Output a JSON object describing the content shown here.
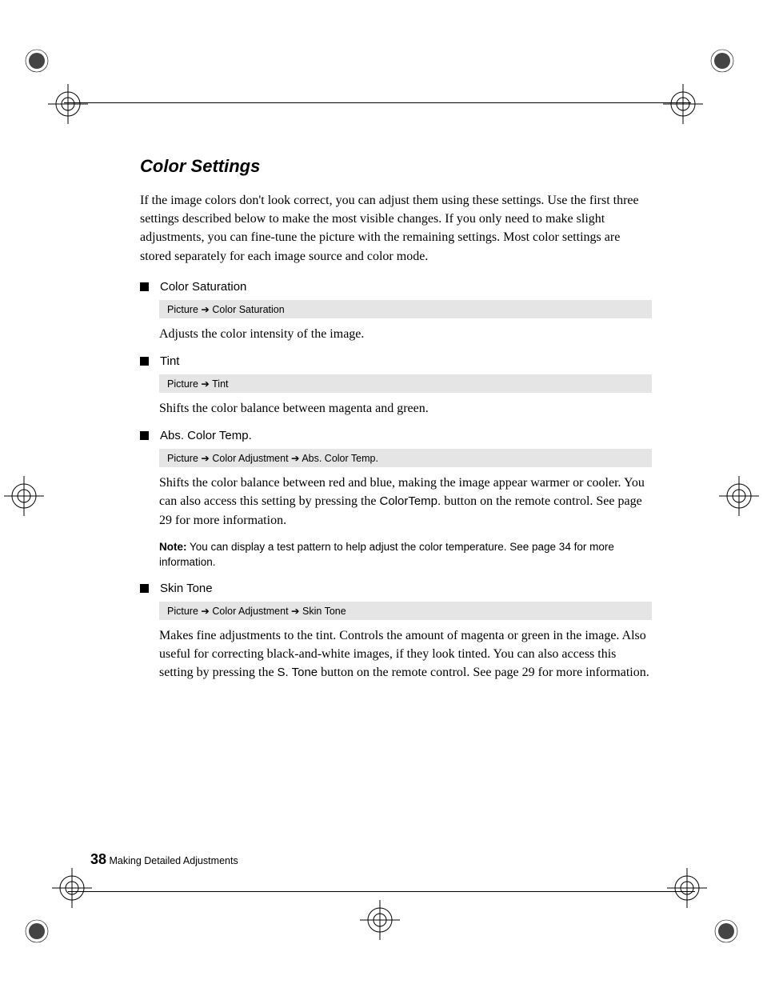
{
  "title": "Color Settings",
  "intro": "If the image colors don't look correct, you can adjust them using these settings. Use the first three settings described below to make the most visible changes. If you only need to make slight adjustments, you can fine-tune the picture with the remaining settings. Most color settings are stored separately for each image source and color mode.",
  "settings": {
    "s1": {
      "name": "Color Saturation",
      "path_a": "Picture",
      "path_b": "Color Saturation",
      "desc": "Adjusts the color intensity of the image."
    },
    "s2": {
      "name": "Tint",
      "path_a": "Picture",
      "path_b": "Tint",
      "desc": "Shifts the color balance between magenta and green."
    },
    "s3": {
      "name": "Abs. Color Temp.",
      "path_a": "Picture",
      "path_b": "Color Adjustment",
      "path_c": "Abs. Color Temp.",
      "desc_pre": "Shifts the color balance between red and blue, making the image appear warmer or cooler. You can also access this setting by pressing the ",
      "desc_btn": "ColorTemp.",
      "desc_post": " button on the remote control. See page 29 for more information.",
      "note_label": "Note:",
      "note_text": " You can display a test pattern to help adjust the color temperature. See page 34 for more information."
    },
    "s4": {
      "name": "Skin Tone",
      "path_a": "Picture",
      "path_b": "Color Adjustment",
      "path_c": "Skin Tone",
      "desc_pre": "Makes fine adjustments to the tint. Controls the amount of magenta or green in the image. Also useful for correcting black-and-white images, if they look tinted. You can also access this setting by pressing the ",
      "desc_btn": "S. Tone",
      "desc_post": " button on the remote control. See page 29 for more information."
    }
  },
  "footer": {
    "page": "38",
    "chapter": " Making Detailed Adjustments"
  },
  "arrow": "➔"
}
